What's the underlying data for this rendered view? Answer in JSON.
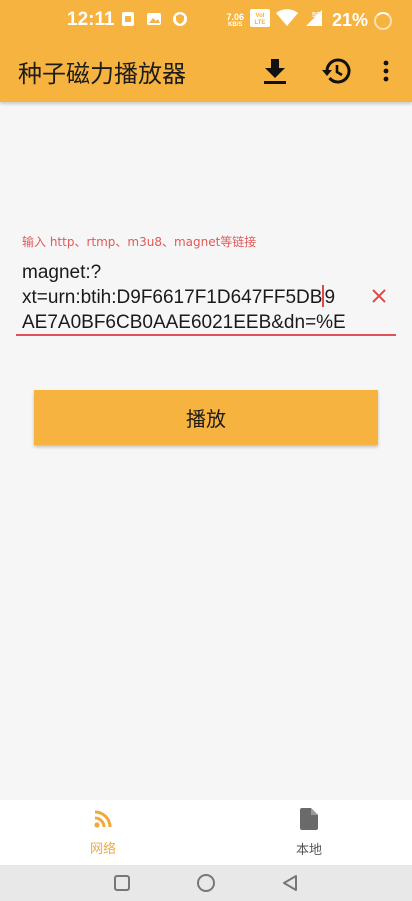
{
  "status_bar": {
    "time": "12:11",
    "net_speed_value": "7.06",
    "net_speed_unit": "KB/S",
    "network_type": "5G",
    "battery_percent": "21%"
  },
  "app_bar": {
    "title": "种子磁力播放器",
    "icons": [
      "download-icon",
      "history-icon",
      "more-vert-icon"
    ]
  },
  "input": {
    "hint": "输入 http、rtmp、m3u8、magnet等链接",
    "lines": [
      "magnet:?",
      "xt=urn:btih:D9F6617F1D647FF5DB",
      "9",
      "AE7A0BF6CB0AAE6021EEB&dn=%E"
    ],
    "clear_icon": "close-icon"
  },
  "play_button": {
    "label": "播放"
  },
  "bottom_nav": {
    "items": [
      {
        "label": "网络",
        "icon": "rss-feed-icon",
        "active": true
      },
      {
        "label": "本地",
        "icon": "file-icon",
        "active": false
      }
    ]
  },
  "colors": {
    "primary": "#f7b33f",
    "accent_red": "#e0505a",
    "active_nav": "#f2a93b"
  }
}
